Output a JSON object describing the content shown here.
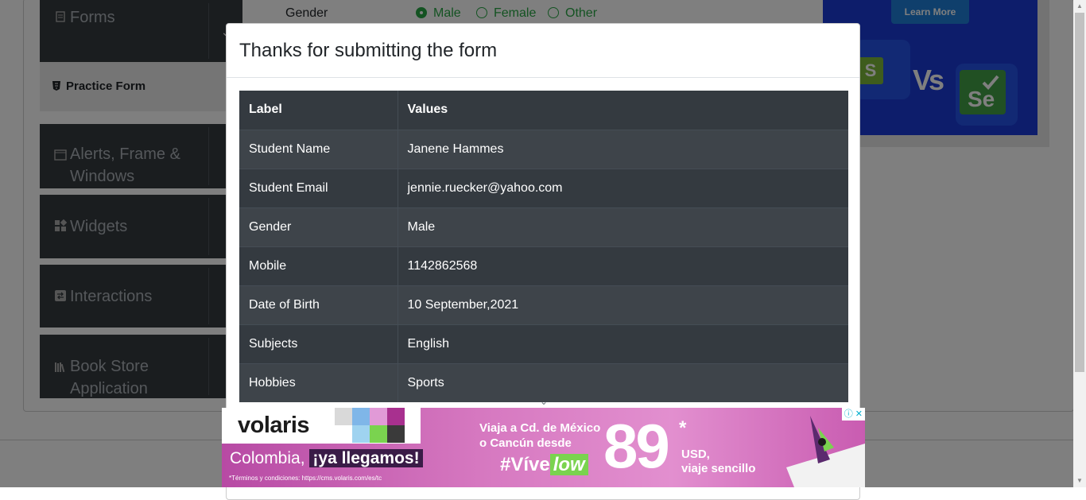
{
  "background": {
    "sidebar": {
      "forms_label": "Forms",
      "practice_form_label": "Practice Form",
      "alerts_label": "Alerts, Frame & Windows",
      "widgets_label": "Widgets",
      "interactions_label": "Interactions",
      "book_store_label": "Book Store Application"
    },
    "form": {
      "gender_label": "Gender",
      "gender_options": [
        "Male",
        "Female",
        "Other"
      ]
    },
    "top_ad": {
      "button_label": "Learn More",
      "vs_text": "Vs"
    }
  },
  "modal": {
    "title": "Thanks for submitting the form",
    "table": {
      "headers": [
        "Label",
        "Values"
      ],
      "rows": [
        {
          "label": "Student Name",
          "value": "Janene Hammes"
        },
        {
          "label": "Student Email",
          "value": "jennie.ruecker@yahoo.com"
        },
        {
          "label": "Gender",
          "value": "Male"
        },
        {
          "label": "Mobile",
          "value": "1142862568"
        },
        {
          "label": "Date of Birth",
          "value": "10 September,2021"
        },
        {
          "label": "Subjects",
          "value": "English"
        },
        {
          "label": "Hobbies",
          "value": "Sports"
        }
      ]
    }
  },
  "bottom_ad": {
    "brand": "volaris",
    "headline_prefix": "Colombia, ",
    "headline_highlight": "¡ya llegamos!",
    "terms": "*Términos y condiciones: https://cms.volaris.com/es/tc",
    "route_line1": "Viaja a Cd. de México",
    "route_line2": "o Cancún desde",
    "hashtag_prefix": "#Víve",
    "hashtag_highlight": "low",
    "price": "89",
    "price_star": "*",
    "currency": "USD,",
    "tagline": "viaje sencillo"
  },
  "colors": {
    "sidebar_bg": "#353a3f",
    "table_dark": "#343a40",
    "table_stripe": "#3e444a",
    "radio_green": "#28a745",
    "ad_blue": "#1a3ad6"
  }
}
